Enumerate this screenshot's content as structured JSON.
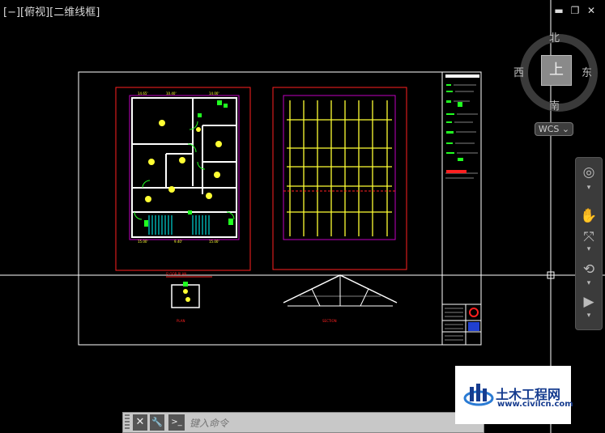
{
  "viewport": {
    "label": "[−][俯视][二维线框]"
  },
  "window_controls": {
    "minimize": "▬",
    "restore": "❐",
    "close": "✕"
  },
  "viewcube": {
    "north": "北",
    "south": "南",
    "east": "东",
    "west": "西",
    "face": "上"
  },
  "wcs": {
    "label": "WCS"
  },
  "command_line": {
    "placeholder": "键入命令",
    "close_glyph": "✕",
    "wrench_glyph": "🔧",
    "prompt_glyph": ">_"
  },
  "drawing": {
    "dims_top": [
      "14.65'",
      "10.40'",
      "14.00'"
    ],
    "dims_bottom": [
      "15.00'",
      "9.40'",
      "15.00'"
    ],
    "title_floor_plan": "FLOOR PLAN",
    "title_section": "SECTION",
    "title_small": "PLAN"
  },
  "watermark": {
    "text_cn": "土木工程网",
    "text_url": "www.civilcn.com"
  },
  "colors": {
    "background": "#000000",
    "border": "#ffffff",
    "red": "#ff2020",
    "magenta": "#c000c0",
    "yellow": "#ffff33",
    "green": "#20ff20",
    "cyan": "#00ffff",
    "watermark_blue": "#163c8f"
  }
}
